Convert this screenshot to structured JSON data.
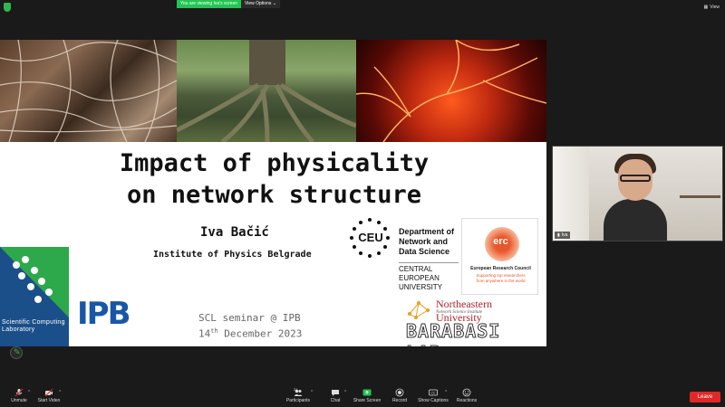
{
  "topbar": {
    "viewing_label": "You are viewing Iva's screen",
    "view_options_label": "View Options",
    "view_label": "View"
  },
  "slide": {
    "title_line1": "Impact of physicality",
    "title_line2": "on network structure",
    "author": "Iva Bačić",
    "affiliation": "Institute of Physics Belgrade",
    "seminar": "SCL seminar @ IPB",
    "date_day": "14",
    "date_sup": "th",
    "date_rest": " December 2023",
    "logos": {
      "scl_text": "Scientific Computing Laboratory",
      "ipb_text": "IPB",
      "ceu_text": "CEU",
      "ceu_dept": [
        "Department of",
        "Network and",
        "Data Science"
      ],
      "ceu_uni": [
        "CENTRAL",
        "EUROPEAN",
        "UNIVERSITY"
      ],
      "erc_word": "erc",
      "erc_name": "European Research Council",
      "erc_tag_line1": "Supporting top researchers",
      "erc_tag_line2": "from anywhere in the world",
      "neu_name": "Northeastern University",
      "neu_sub": "Network Science Institute",
      "barabasi": "BARABASI LAB"
    }
  },
  "camera": {
    "participant_name": "Iva"
  },
  "toolbar": {
    "unmute": "Unmute",
    "start_video": "Start Video",
    "participants": "Participants",
    "participants_count": "21",
    "chat": "Chat",
    "share_screen": "Share Screen",
    "record": "Record",
    "show_captions": "Show Captions",
    "reactions": "Reactions",
    "leave": "Leave"
  },
  "colors": {
    "zoom_green": "#23c552",
    "leave_red": "#e02828",
    "ipb_blue": "#1a56a8",
    "scl_blue": "#1a4f8a",
    "erc_orange": "#e8562a",
    "neu_red": "#b0232a"
  }
}
